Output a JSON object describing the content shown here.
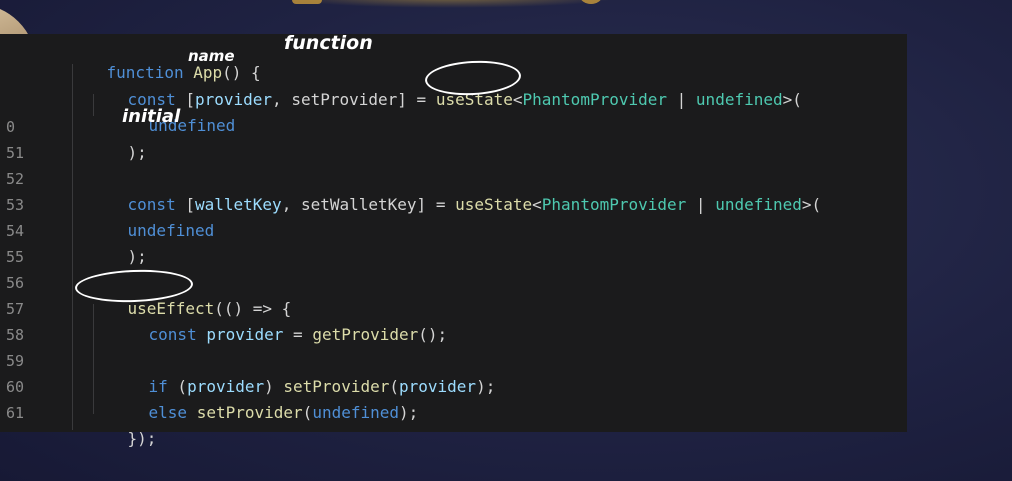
{
  "gutter": {
    "lines": [
      "0",
      "51",
      "52",
      "53",
      "54",
      "55",
      "56",
      "57",
      "58",
      "59",
      "60",
      "61"
    ]
  },
  "code": {
    "l47_kw": "function",
    "l47_fn": "App",
    "l47_rest": "() {",
    "l48_kw": "const",
    "l48_open": "[",
    "l48_var1": "provider",
    "l48_comma": ", ",
    "l48_var2": "setProvider",
    "l48_eq": "] = ",
    "l48_hook": "useState",
    "l48_lt": "<",
    "l48_type": "PhantomProvider",
    "l48_pipe": " | ",
    "l48_undef": "undefined",
    "l48_end": ">(",
    "l49_undef": "undefined",
    "l50_close": ");",
    "l52_kw": "const",
    "l52_open": "[",
    "l52_var1": "walletKey",
    "l52_comma": ", ",
    "l52_var2": "setWalletKey",
    "l52_eq": "] = ",
    "l52_hook": "useState",
    "l52_lt": "<",
    "l52_type": "PhantomProvider",
    "l52_pipe": " | ",
    "l52_undef": "undefined",
    "l52_end": ">(",
    "l53_undef": "undefined",
    "l54_close": ");",
    "l56_hook": "useEffect",
    "l56_rest": "(() => {",
    "l57_kw": "const",
    "l57_var": "provider",
    "l57_eq": " = ",
    "l57_fn": "getProvider",
    "l57_end": "();",
    "l59_kw": "if",
    "l59_open": " (",
    "l59_var": "provider",
    "l59_close": ") ",
    "l59_fn": "setProvider",
    "l59_paren": "(",
    "l59_arg": "provider",
    "l59_end": ");",
    "l60_kw": "else",
    "l60_sp": " ",
    "l60_fn": "setProvider",
    "l60_paren": "(",
    "l60_arg": "undefined",
    "l60_end": ");",
    "l61_close": "});"
  },
  "annotations": {
    "function_note": "function",
    "name_note": "name",
    "initial_note": "initial"
  },
  "colors": {
    "keyword": "#4f8fd6",
    "function": "#dcdcaa",
    "type": "#4ec9b0",
    "variable": "#9cdcfe",
    "plain": "#d4d4d4",
    "editor_bg": "#1b1b1c"
  }
}
